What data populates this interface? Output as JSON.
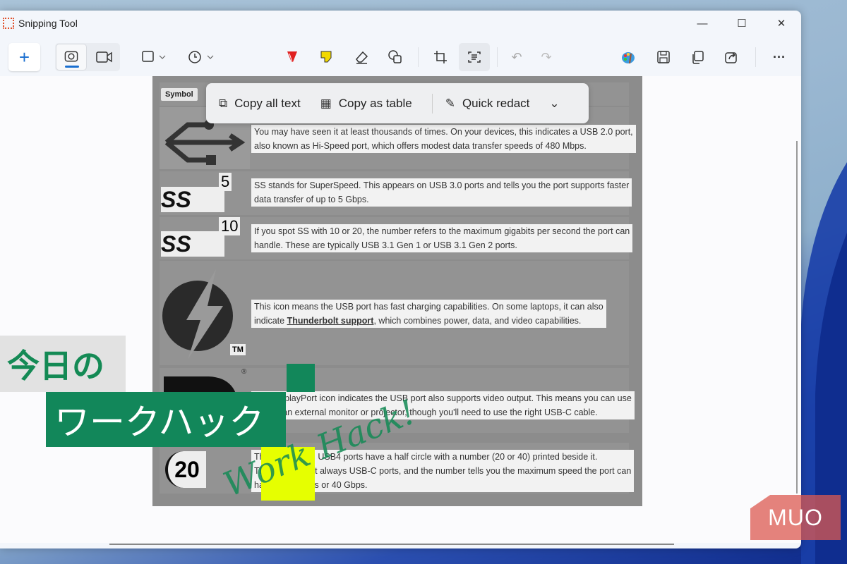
{
  "window": {
    "title": "Snipping Tool",
    "minimize": "—",
    "maximize": "☐",
    "close": "✕"
  },
  "toolbar": {
    "new": "+",
    "more": "···"
  },
  "text_actions": {
    "copy_all": "Copy all text",
    "copy_table": "Copy as table",
    "quick_redact": "Quick redact"
  },
  "snip": {
    "header": "Symbol",
    "rows": [
      {
        "badge": "",
        "lines": [
          "You may have seen it at least thousands of times. On your devices, this indicates a USB 2.0 port,",
          "also known as Hi-Speed port, which offers modest data transfer speeds of 480 Mbps."
        ]
      },
      {
        "badge": "5",
        "lines": [
          "SS stands for SuperSpeed. This appears on USB 3.0 ports and tells you the port supports faster",
          "data transfer of up to 5 Gbps."
        ]
      },
      {
        "badge": "10",
        "lines": [
          "If you spot SS with 10 or 20, the number refers to the maximum gigabits per second the port can",
          "handle. These are typically USB 3.1 Gen 1 or USB 3.1 Gen 2 ports."
        ]
      },
      {
        "badge": "TM",
        "lines": [
          "This icon means the USB port has fast charging capabilities. On some laptops, it can also",
          "indicate ",
          "Thunderbolt support",
          ", which combines power, data, and video capabilities."
        ]
      },
      {
        "badge": "®",
        "lines": [
          "The DisplayPort icon indicates the USB port also supports video output. This means you can use",
          "plug in an external monitor or projector, though you'll need to use the right USB-C cable."
        ]
      },
      {
        "badge": "20",
        "lines": [
          "These standard USB4 ports have a half circle with a number (20 or 40) printed beside it.",
          "They are almost always USB-C ports, and the number tells you the maximum speed the port can",
          "handle: 20 Gbps or 40 Gbps."
        ]
      }
    ],
    "ss_label": "SS"
  },
  "overlay": {
    "title_top": "今日の",
    "title_bottom": "ワークハック",
    "signature": "Work Hack!",
    "logo": "MUO"
  },
  "colors": {
    "green": "#12875a",
    "yellow": "#e6ff00",
    "accent": "#1a6fd0"
  }
}
